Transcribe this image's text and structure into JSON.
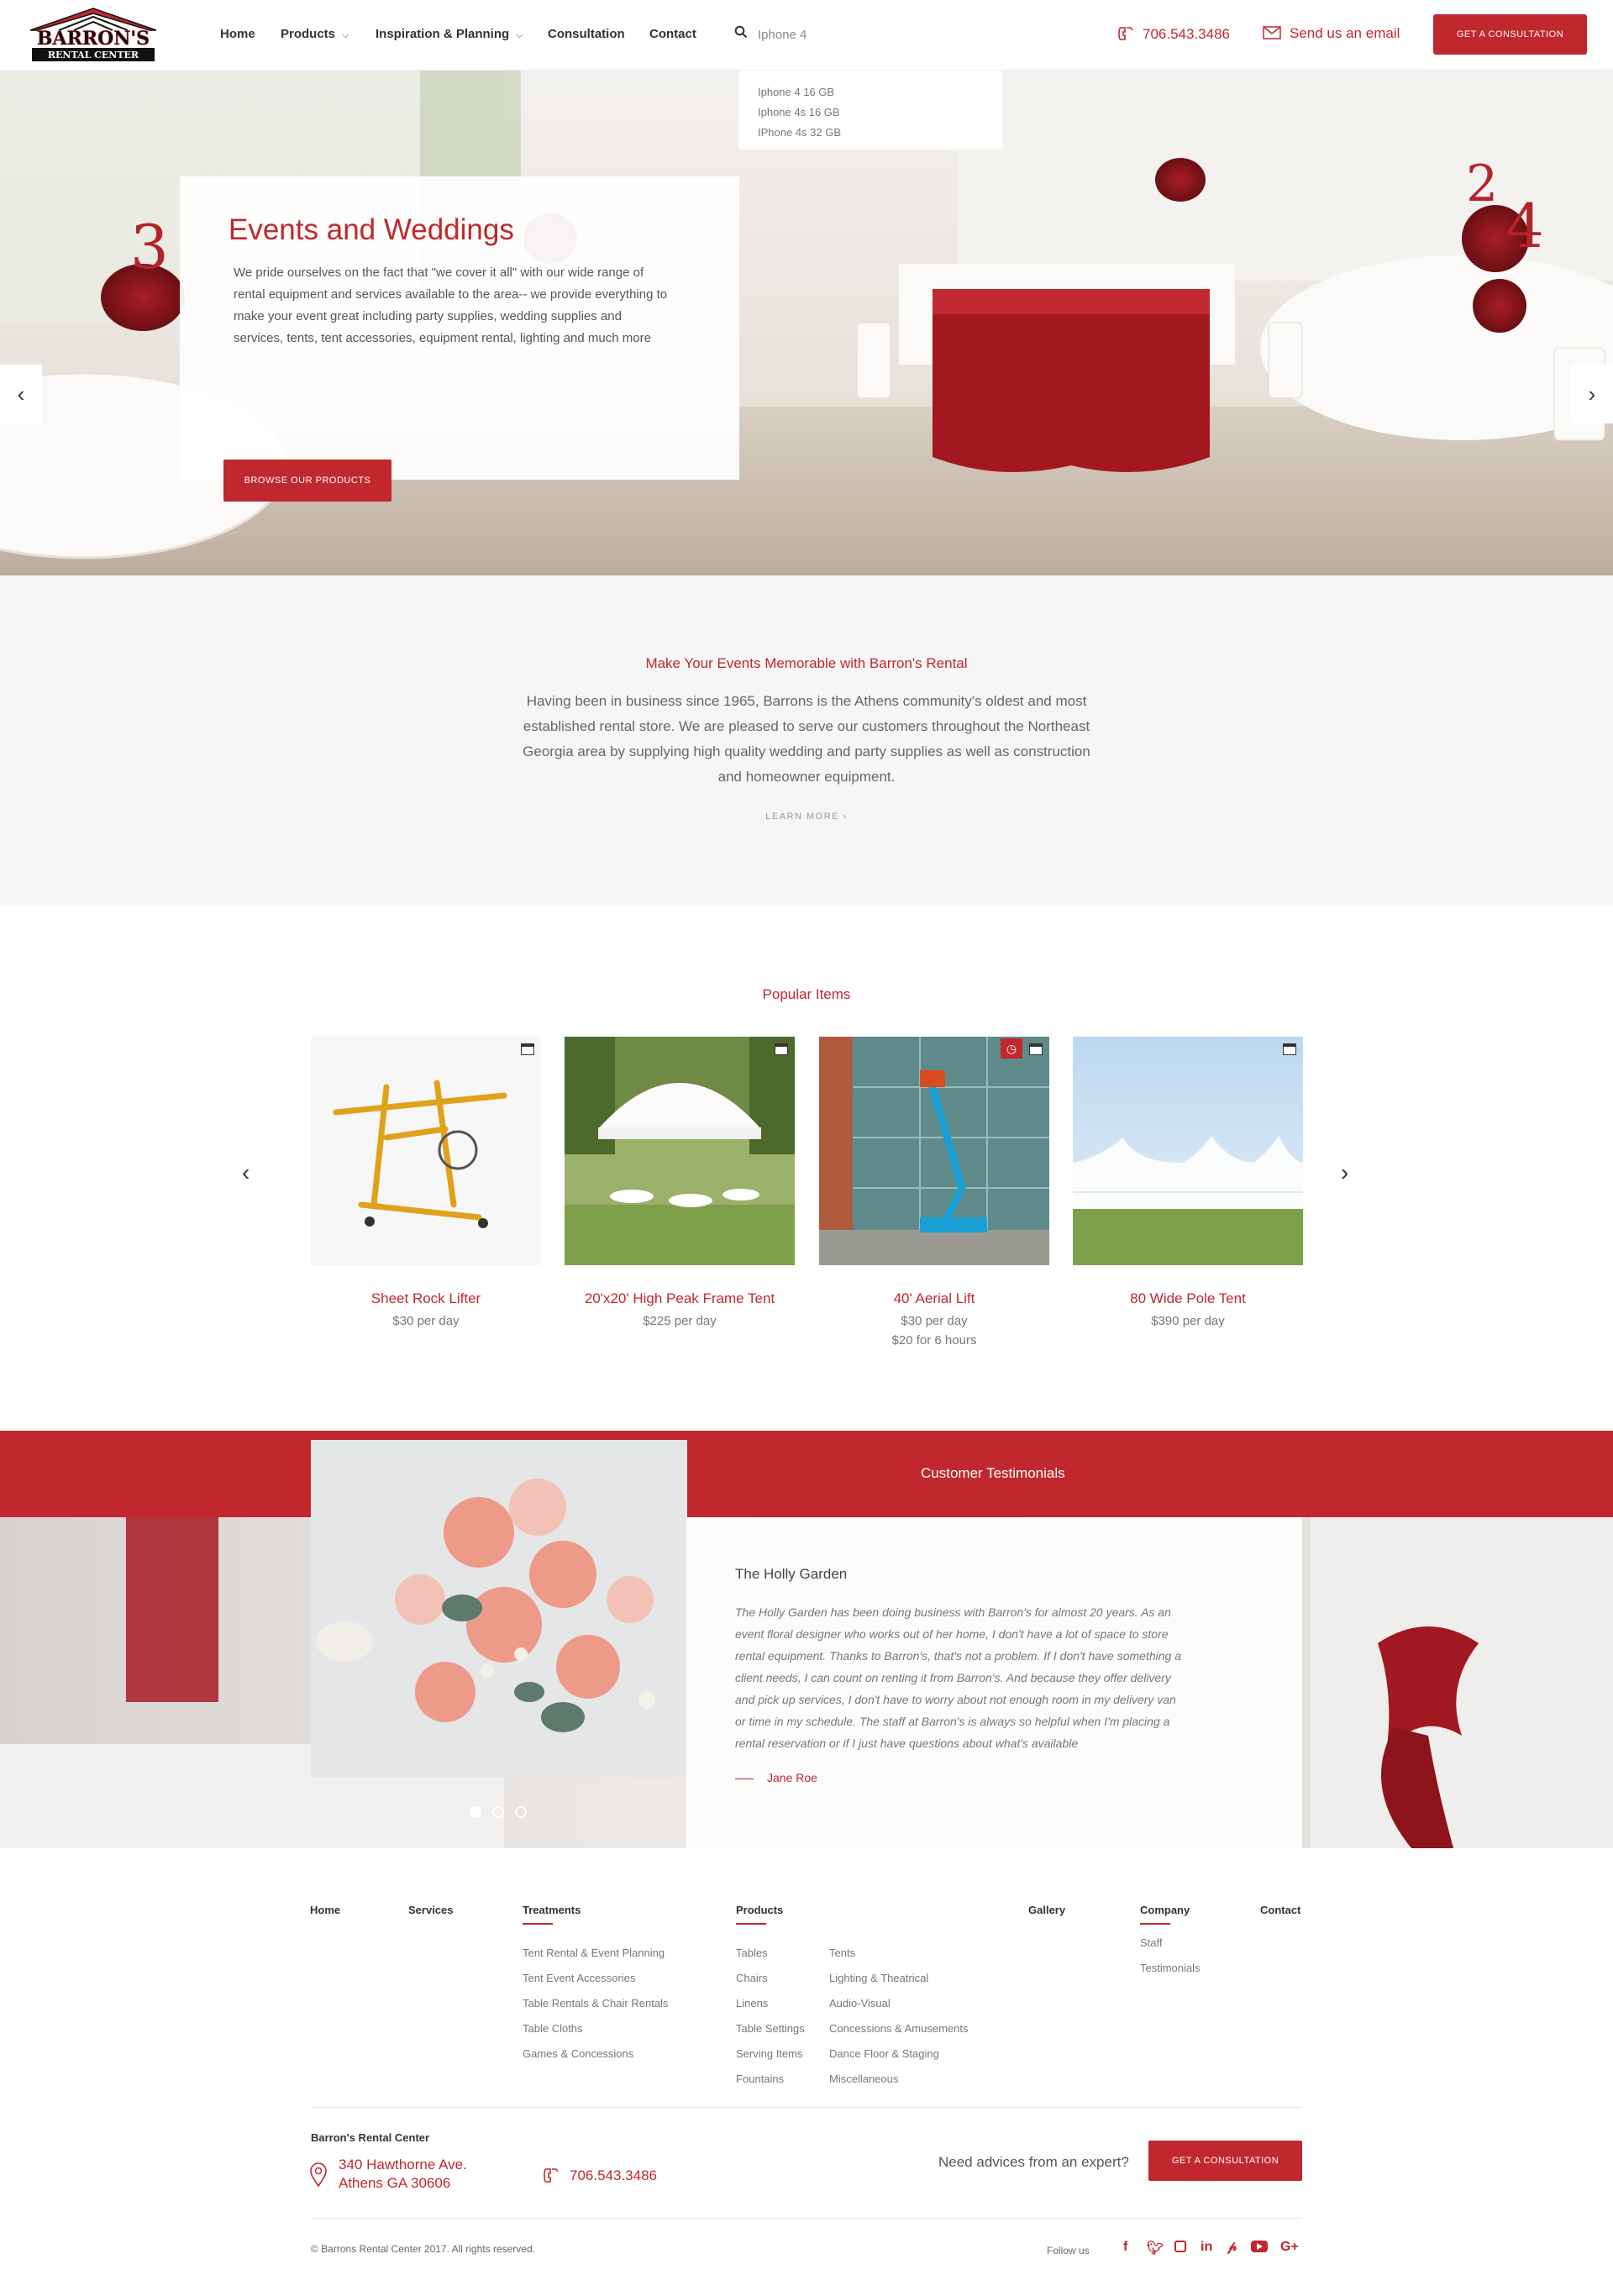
{
  "brand": {
    "name": "BARRON'S",
    "sub": "RENTAL CENTER"
  },
  "nav": {
    "home": "Home",
    "products": "Products",
    "inspiration": "Inspiration & Planning",
    "consultation": "Consultation",
    "contact": "Contact"
  },
  "search": {
    "value": "Iphone 4",
    "suggestions": [
      "Iphone 4 16 GB",
      "Iphone 4s 16 GB",
      "IPhone 4s 32 GB"
    ]
  },
  "header": {
    "phone": "706.543.3486",
    "email": "Send us an email",
    "cta": "GET A CONSULTATION"
  },
  "hero": {
    "title": "Events and Weddings",
    "text": "We pride ourselves on the fact that \"we cover it all\" with our wide range of rental equipment and services available to the area-- we provide everything to make your event great including party supplies, wedding supplies and services, tents, tent accessories, equipment rental, lighting and much more",
    "button": "BROWSE OUR PRODUCTS",
    "table_numbers": [
      "3",
      "2",
      "4"
    ]
  },
  "intro": {
    "title": "Make Your Events Memorable with Barron's Rental",
    "text": "Having been in business since 1965, Barrons is the Athens community's oldest and most established rental store. We are pleased to serve our customers throughout the Northeast Georgia area by supplying high quality wedding and party supplies as well as construction and homeowner equipment.",
    "link": "LEARN MORE"
  },
  "popular": {
    "title": "Popular Items",
    "items": [
      {
        "name": "Sheet Rock Lifter",
        "price": "$30 per day"
      },
      {
        "name": "20'x20' High Peak Frame Tent",
        "price": "$225 per day"
      },
      {
        "name": "40' Aerial Lift",
        "price": "$30 per day",
        "price2": "$20 for 6 hours"
      },
      {
        "name": "80 Wide Pole Tent",
        "price": "$390 per day"
      }
    ]
  },
  "testimonials": {
    "heading": "Customer Testimonials",
    "company": "The Holly Garden",
    "quote": "The Holly Garden has been doing business with Barron's for almost 20 years.  As an event floral designer who works out of her home, I don't have a lot of space to store rental equipment.  Thanks to Barron's, that's not a problem.  If I don't have something a client needs, I can count on renting it from Barron's.  And because they offer delivery and pick up services, I don't have to worry about not enough room in my delivery van or time in my schedule.  The staff at Barron's is always so helpful when I'm placing a rental reservation or if I just have questions about what's available",
    "author": "Jane Roe"
  },
  "footer": {
    "cols": {
      "home": "Home",
      "services": "Services",
      "treatments": "Treatments",
      "products": "Products",
      "gallery": "Gallery",
      "company": "Company",
      "contact": "Contact"
    },
    "treatments": [
      "Tent Rental & Event Planning",
      "Tent Event Accessories",
      "Table Rentals & Chair Rentals",
      "Table Cloths",
      "Games & Concessions"
    ],
    "products_a": [
      "Tables",
      "Chairs",
      "Linens",
      "Table Settings",
      "Serving Items",
      "Fountains"
    ],
    "products_b": [
      "Tents",
      "Lighting & Theatrical",
      "Audio-Visual",
      "Concessions & Amusements",
      "Dance Floor & Staging",
      "Miscellaneous"
    ],
    "company": [
      "Staff",
      "Testimonials"
    ],
    "company_name": "Barron's Rental Center",
    "address1": "340 Hawthorne Ave.",
    "address2": "Athens GA 30606",
    "phone": "706.543.3486",
    "need": "Need advices from an expert?",
    "cta": "GET A CONSULTATION",
    "copyright": "© Barrons Rental Center 2017. All rights reserved.",
    "follow": "Follow us",
    "social": [
      "f",
      "t",
      "i",
      "in",
      "p",
      "yt",
      "G+"
    ]
  },
  "colors": {
    "accent": "#c0282d",
    "intro_bg": "#f6f6f6"
  }
}
